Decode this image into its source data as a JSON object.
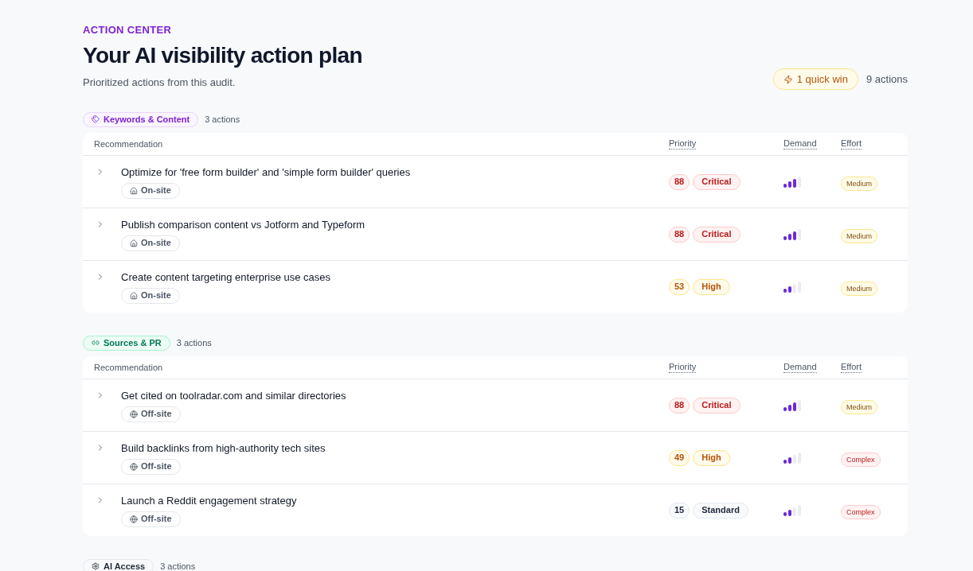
{
  "header": {
    "eyebrow": "ACTION CENTER",
    "title": "Your AI visibility action plan",
    "subtitle": "Prioritized actions from this audit.",
    "quick_win": "1 quick win",
    "total": "9 actions"
  },
  "sections": [
    {
      "kind": "keywords",
      "label": "Keywords & Content",
      "count": "3 actions",
      "columns": [
        "Recommendation",
        "Priority",
        "Demand",
        "Effort"
      ],
      "rows": [
        {
          "title": "Optimize for 'free form builder' and 'simple form builder' queries",
          "location": {
            "kind": "onsite",
            "label": "On-site"
          },
          "score": "88",
          "priority": {
            "kind": "critical",
            "label": "Critical"
          },
          "demand": {
            "level": 0.75
          },
          "effort": {
            "kind": "medium",
            "label": "Medium"
          },
          "expanded": false
        },
        {
          "title": "Publish comparison content vs Jotform and Typeform",
          "location": {
            "kind": "onsite",
            "label": "On-site"
          },
          "score": "88",
          "priority": {
            "kind": "critical",
            "label": "Critical"
          },
          "demand": {
            "level": 0.75
          },
          "effort": {
            "kind": "medium",
            "label": "Medium"
          },
          "expanded": false
        },
        {
          "title": "Create content targeting enterprise use cases",
          "location": {
            "kind": "onsite",
            "label": "On-site"
          },
          "score": "53",
          "priority": {
            "kind": "high",
            "label": "High"
          },
          "demand": {
            "level": 0.5
          },
          "effort": {
            "kind": "medium",
            "label": "Medium"
          },
          "expanded": false
        }
      ]
    },
    {
      "kind": "sources",
      "label": "Sources & PR",
      "count": "3 actions",
      "columns": [
        "Recommendation",
        "Priority",
        "Demand",
        "Effort"
      ],
      "rows": [
        {
          "title": "Get cited on toolradar.com and similar directories",
          "location": {
            "kind": "offsite",
            "label": "Off-site"
          },
          "score": "88",
          "priority": {
            "kind": "critical",
            "label": "Critical"
          },
          "demand": {
            "level": 0.75
          },
          "effort": {
            "kind": "medium",
            "label": "Medium"
          },
          "expanded": false
        },
        {
          "title": "Build backlinks from high-authority tech sites",
          "location": {
            "kind": "offsite",
            "label": "Off-site"
          },
          "score": "49",
          "priority": {
            "kind": "high",
            "label": "High"
          },
          "demand": {
            "level": 0.5
          },
          "effort": {
            "kind": "complex",
            "label": "Complex"
          },
          "expanded": false
        },
        {
          "title": "Launch a Reddit engagement strategy",
          "location": {
            "kind": "offsite",
            "label": "Off-site"
          },
          "score": "15",
          "priority": {
            "kind": "standard",
            "label": "Standard"
          },
          "demand": {
            "level": 0.5
          },
          "effort": {
            "kind": "complex",
            "label": "Complex"
          },
          "expanded": false
        }
      ]
    },
    {
      "kind": "access",
      "label": "AI Access",
      "count": "3 actions"
    }
  ]
}
